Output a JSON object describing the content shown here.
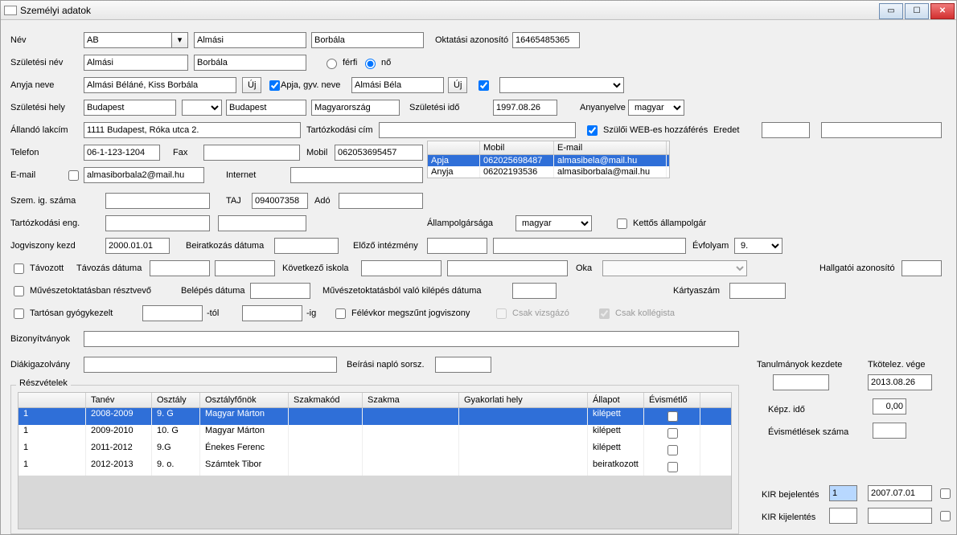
{
  "window": {
    "title": "Személyi adatok"
  },
  "winbtns": {
    "min": "▭",
    "max": "☐",
    "close": "✕"
  },
  "labels": {
    "nev": "Név",
    "szulnev": "Születési név",
    "anyja": "Anyja neve",
    "szulhely": "Születési hely",
    "lakcim": "Állandó lakcím",
    "telefon": "Telefon",
    "email": "E-mail",
    "szig": "Szem. ig. száma",
    "tartozkodasi_eng": "Tartózkodási eng.",
    "jogviszony": "Jogviszony kezd",
    "tavozott": "Távozott",
    "muvesz": "Művészetoktatásban résztvevő",
    "tartos": "Tartósan gyógykezelt",
    "bizonyitvanyok": "Bizonyítványok",
    "diak": "Diákigazolvány",
    "oktatasi_azon": "Oktatási azonosító",
    "ferfi": "férfi",
    "no": "nő",
    "uj": "Új",
    "apjagyvneve": "Apja, gyv. neve",
    "szulido": "Születési idő",
    "anyanyelve": "Anyanyelve",
    "tartozkodasi_cim": "Tartózkodási cím",
    "szuloi_web": "Szülői WEB-es hozzáférés",
    "eredet": "Eredet",
    "fax": "Fax",
    "mobil": "Mobil",
    "internet": "Internet",
    "taj": "TAJ",
    "ado": "Adó",
    "allampolg": "Állampolgársága",
    "kettos": "Kettős állampolgár",
    "beiratkozas": "Beiratkozás dátuma",
    "elozo": "Előző intézmény",
    "evfolyam": "Évfolyam",
    "tavozasdatum": "Távozás dátuma",
    "kovetkezo": "Következő iskola",
    "oka": "Oka",
    "hallgatoi": "Hallgatói azonosító",
    "belepes": "Belépés dátuma",
    "muveszkilep": "Művészetoktatásból való kilépés dátuma",
    "kartyaszam": "Kártyaszám",
    "tol": "-tól",
    "ig": "-ig",
    "felevkor": "Félévkor megszűnt jogviszony",
    "csak_vizsg": "Csak vizsgázó",
    "csak_koll": "Csak kollégista",
    "beirasi": "Beírási napló sorsz.",
    "tanul_kezd": "Tanulmányok kezdete",
    "tkotelez": "Tkötelez. vége",
    "kepz_ido": "Képz. idő",
    "evismet": "Évismétlések száma",
    "kir_be": "KIR bejelentés",
    "kir_ki": "KIR kijelentés"
  },
  "fields": {
    "nev_prefix": "AB",
    "nev_vez": "Almási",
    "nev_ker": "Borbála",
    "okt_azon": "16465485365",
    "szulnev_vez": "Almási",
    "szulnev_ker": "Borbála",
    "anyja_neve": "Almási Béláné, Kiss Borbála",
    "apja_neve": "Almási Béla",
    "szul_varos": "Budapest",
    "szul_varos2": "Budapest",
    "szul_orszag": "Magyarország",
    "szul_ido": "1997.08.26",
    "anyanyelv": "magyar",
    "lakcim": "1111 Budapest, Róka utca 2.",
    "telefon": "06-1-123-1204",
    "mobil": "062053695457",
    "email": "almasiborbala2@mail.hu",
    "taj": "094007358",
    "allampolg": "magyar",
    "jogviszony_kezd": "2000.01.01",
    "evfolyam": "9.",
    "tkotelez_vege": "2013.08.26",
    "kepz_ido": "0,00",
    "kir_be_1": "1",
    "kir_be_2": "2007.07.01"
  },
  "contacts": {
    "headers": [
      "",
      "Mobil",
      "E-mail"
    ],
    "rows": [
      {
        "who": "Apja",
        "mobil": "062025698487",
        "email": "almasibela@mail.hu",
        "selected": true
      },
      {
        "who": "Anyja",
        "mobil": "06202193536",
        "email": "almasiborbala@mail.hu",
        "selected": false
      }
    ]
  },
  "reszvetelek": {
    "legend": "Részvételek",
    "headers": [
      "",
      "Tanév",
      "Osztály",
      "Osztályfőnök",
      "Szakmakód",
      "Szakma",
      "Gyakorlati hely",
      "Állapot",
      "Évismétlő"
    ],
    "rows": [
      {
        "c0": "1",
        "tanev": "2008-2009",
        "osztaly": "9. G",
        "of": "Magyar Márton",
        "szkod": "",
        "szakma": "",
        "gyh": "",
        "allapot": "kilépett",
        "sel": true
      },
      {
        "c0": "1",
        "tanev": "2009-2010",
        "osztaly": "10. G",
        "of": "Magyar Márton",
        "szkod": "",
        "szakma": "",
        "gyh": "",
        "allapot": "kilépett",
        "sel": false
      },
      {
        "c0": "1",
        "tanev": "2011-2012",
        "osztaly": "9.G",
        "of": "Énekes Ferenc",
        "szkod": "",
        "szakma": "",
        "gyh": "",
        "allapot": "kilépett",
        "sel": false
      },
      {
        "c0": "1",
        "tanev": "2012-2013",
        "osztaly": "9. o.",
        "of": "Számtek Tibor",
        "szkod": "",
        "szakma": "",
        "gyh": "",
        "allapot": "beiratkozott",
        "sel": false
      }
    ]
  }
}
